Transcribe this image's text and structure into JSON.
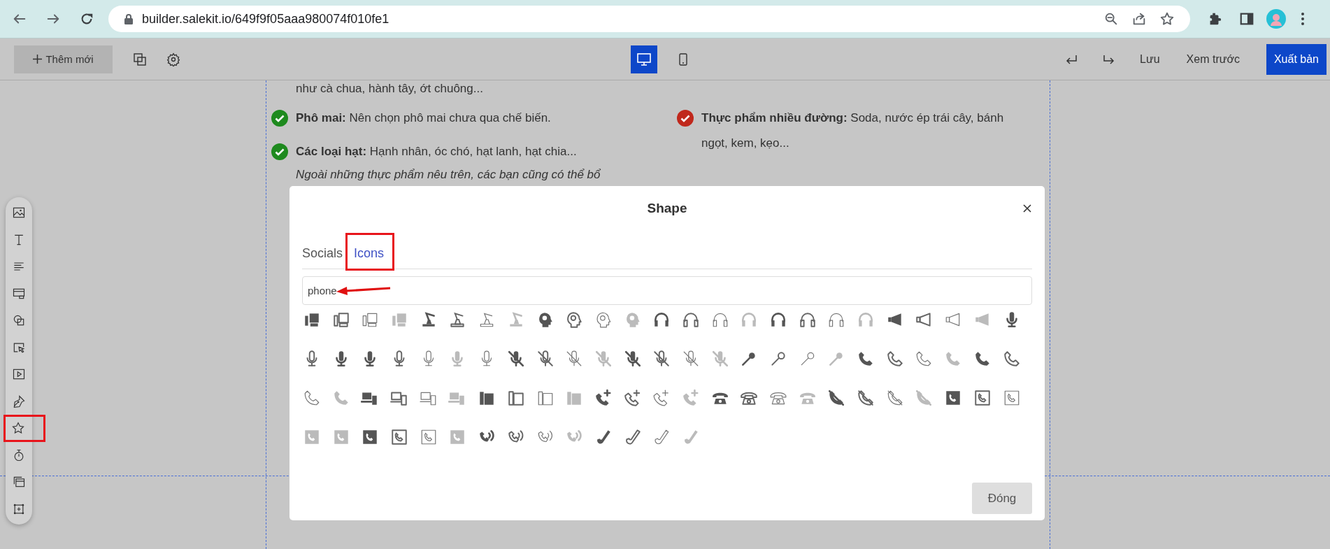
{
  "browser": {
    "url": "builder.salekit.io/649f9f05aaa980074f010fe1"
  },
  "toolbar": {
    "add_button": "Thêm mới",
    "view_modes": [
      {
        "kind": "desktop",
        "selected": true
      },
      {
        "kind": "mobile",
        "selected": false
      }
    ],
    "actions": [
      "Lưu",
      "Xem trước"
    ],
    "publish_button": "Xuất bản"
  },
  "sidebar": {
    "items": [
      {
        "kind": "image",
        "highlighted": false
      },
      {
        "kind": "text",
        "highlighted": false
      },
      {
        "kind": "paragraph",
        "highlighted": false
      },
      {
        "kind": "section",
        "highlighted": false
      },
      {
        "kind": "shapes",
        "highlighted": false
      },
      {
        "kind": "cursor",
        "highlighted": false
      },
      {
        "kind": "video",
        "highlighted": false
      },
      {
        "kind": "pen",
        "highlighted": false
      },
      {
        "kind": "star",
        "highlighted": true
      },
      {
        "kind": "timer",
        "highlighted": false
      },
      {
        "kind": "windows",
        "highlighted": false
      },
      {
        "kind": "frame",
        "highlighted": false
      }
    ]
  },
  "content": {
    "columns": [
      {
        "intro": "như cà chua, hành tây, ớt chuông...",
        "items": [
          {
            "text": "**Phô mai:** Nên chọn phô mai chưa qua chế biến.",
            "color": "#1e8a1e"
          },
          {
            "text": "**Các loại hạt:** Hạnh nhân, óc chó, hạt lanh, hạt chia...",
            "color": "#1e8a1e"
          }
        ],
        "note": "Ngoài những thực phẩm nêu trên, các bạn cũng có thể bổ"
      },
      {
        "items": [
          {
            "text": "**Thực phẩm nhiều đường:** Soda, nước ép trái cây, bánh ngọt, kem, kẹo...",
            "color": "#c0281c"
          }
        ]
      }
    ]
  },
  "modal": {
    "title": "Shape",
    "tabs": [
      {
        "label": "Socials",
        "selected": false,
        "highlighted": false
      },
      {
        "label": "Icons",
        "selected": true,
        "highlighted": true
      }
    ],
    "search": {
      "value": "phone",
      "annotated": true
    },
    "close_button": "Đóng"
  }
}
